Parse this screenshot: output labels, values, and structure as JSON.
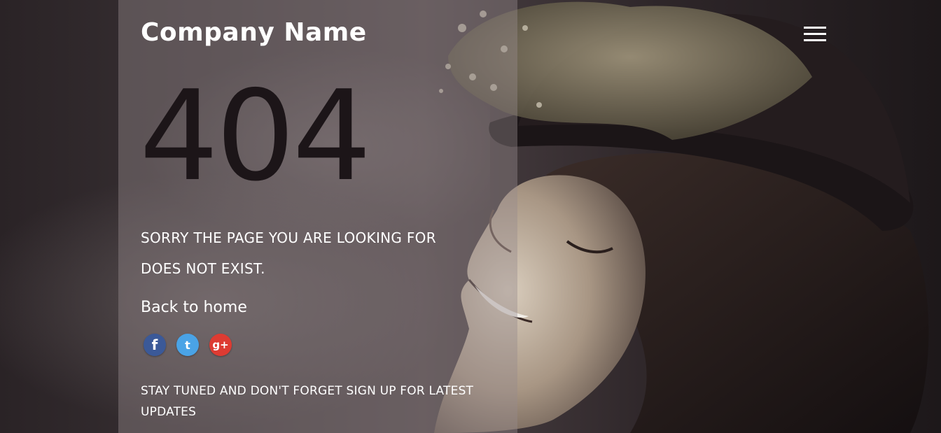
{
  "header": {
    "brand": "Company Name",
    "menu_icon": "hamburger-menu-icon"
  },
  "error": {
    "code": "404",
    "message": "SORRY THE PAGE YOU ARE LOOKING FOR DOES NOT EXIST."
  },
  "actions": {
    "home_link": "Back to home"
  },
  "social": {
    "facebook": {
      "icon": "facebook-icon",
      "glyph": "f",
      "color": "#3b5998"
    },
    "twitter": {
      "icon": "twitter-icon",
      "glyph": "t",
      "color": "#4aa3e6"
    },
    "google_plus": {
      "icon": "google-plus-icon",
      "glyph": "g+",
      "color": "#dd3b32"
    }
  },
  "footer": {
    "note": "STAY TUNED AND DON'T FORGET SIGN UP FOR LATEST UPDATES"
  },
  "colors": {
    "panel_overlay": "rgba(150,138,140,0.42)",
    "code_text": "#1c1518",
    "text": "#ffffff"
  }
}
